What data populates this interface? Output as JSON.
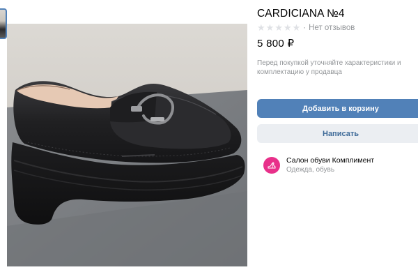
{
  "product": {
    "title": "CARDICIANA №4",
    "rating": {
      "filled_stars": 0,
      "max_stars": 5,
      "reviews_text": "Нет отзывов"
    },
    "price": "5 800 ₽",
    "note": "Перед покупкой уточняйте характеристики и комплектацию у продавца"
  },
  "actions": {
    "add_to_cart": "Добавить в корзину",
    "message": "Написать"
  },
  "seller": {
    "name": "Салон обуви Комплимент",
    "category": "Одежда, обувь"
  },
  "colors": {
    "accent": "#5181b8",
    "secondary_button_bg": "#ebeef2",
    "secondary_button_text": "#3f6b99",
    "muted_text": "#939699",
    "seller_avatar": "#e8308a"
  },
  "icons": {
    "star": "star-icon",
    "seller_avatar": "shoe-logo-icon"
  }
}
